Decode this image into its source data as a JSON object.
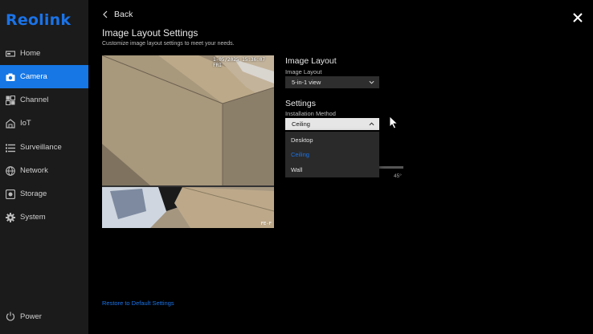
{
  "sidebar": {
    "logo": "Reolink",
    "items": [
      {
        "label": "Home",
        "icon": "home-icon"
      },
      {
        "label": "Camera",
        "icon": "camera-icon",
        "active": true
      },
      {
        "label": "Channel",
        "icon": "grid-icon"
      },
      {
        "label": "IoT",
        "icon": "iot-icon"
      },
      {
        "label": "Surveillance",
        "icon": "list-icon"
      },
      {
        "label": "Network",
        "icon": "globe-icon"
      },
      {
        "label": "Storage",
        "icon": "storage-icon"
      },
      {
        "label": "System",
        "icon": "gear-icon"
      }
    ],
    "power_label": "Power"
  },
  "header": {
    "back_label": "Back",
    "title": "Image Layout Settings",
    "subtitle": "Customize image layout settings to meet your needs."
  },
  "preview": {
    "timestamp": "1-05/2025 15:36:07 FRI",
    "camera_label": "FE-F"
  },
  "image_layout": {
    "section_title": "Image Layout",
    "field_label": "Image Layout",
    "value": "5-in-1 view"
  },
  "settings": {
    "section_title": "Settings",
    "installation_label": "Installation Method",
    "installation_value": "Ceiling",
    "options": [
      "Desktop",
      "Ceiling",
      "Wall"
    ],
    "selected_option": "Ceiling",
    "slider_min_label": "45",
    "slider_max_label": "45°"
  },
  "footer": {
    "restore_label": "Restore to Default Settings"
  },
  "colors": {
    "accent": "#1677e5",
    "sidebar_bg": "#1b1b1b",
    "page_bg": "#000000"
  }
}
